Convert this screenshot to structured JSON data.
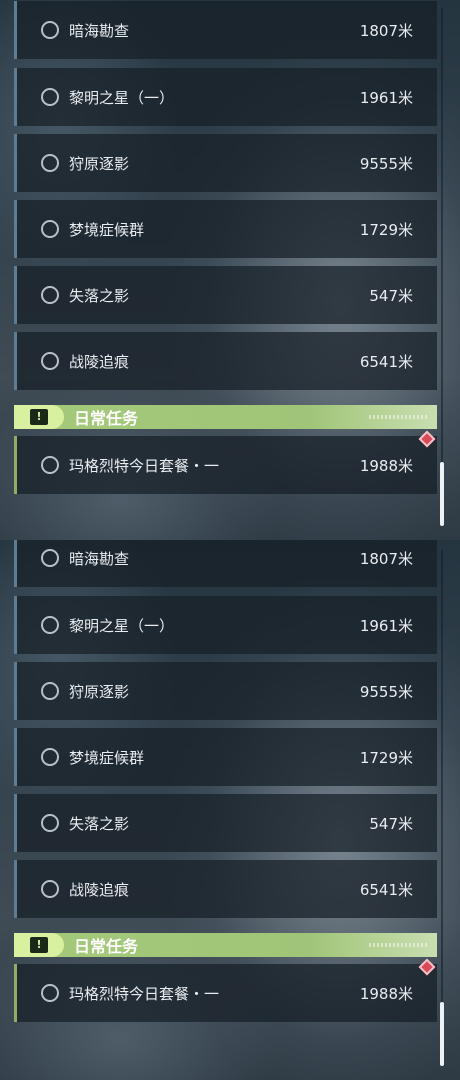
{
  "quest_list": {
    "quests": [
      {
        "title": "暗海勘查",
        "distance": "1807米"
      },
      {
        "title": "黎明之星（一）",
        "distance": "1961米"
      },
      {
        "title": "狩原逐影",
        "distance": "9555米"
      },
      {
        "title": "梦境症候群",
        "distance": "1729米"
      },
      {
        "title": "失落之影",
        "distance": "547米"
      },
      {
        "title": "战陵追痕",
        "distance": "6541米"
      }
    ],
    "daily_section": {
      "title": "日常任务",
      "icon": "exclamation-icon",
      "accent_color": "#a4c97a"
    },
    "daily_quests": [
      {
        "title": "玛格烈特今日套餐・一",
        "distance": "1988米",
        "has_marker": true
      }
    ]
  },
  "colors": {
    "row_border": "#5e7d94",
    "daily_border": "#8fae63",
    "marker": "#d84a5a"
  }
}
